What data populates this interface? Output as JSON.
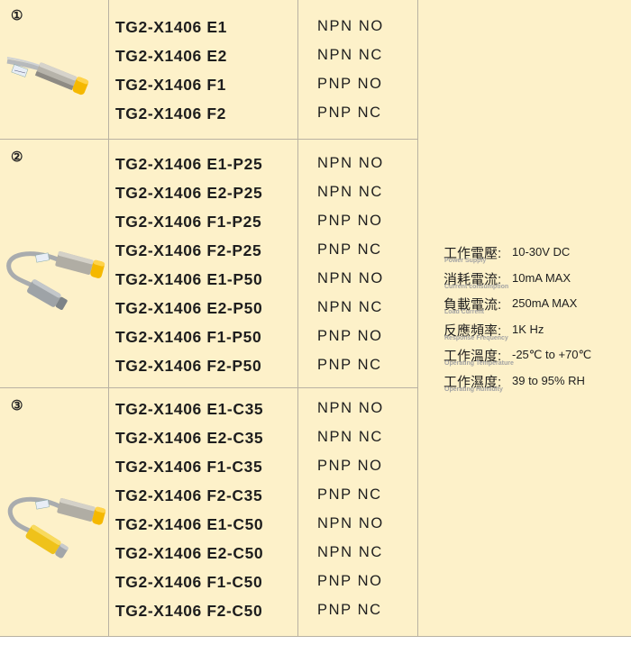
{
  "groups": [
    {
      "number": "①",
      "models": [
        "TG2-X1406 E1",
        "TG2-X1406 E2",
        "TG2-X1406 F1",
        "TG2-X1406 F2"
      ],
      "types": [
        "NPN NO",
        "NPN NC",
        "PNP NO",
        "PNP NC"
      ]
    },
    {
      "number": "②",
      "models": [
        "TG2-X1406 E1-P25",
        "TG2-X1406 E2-P25",
        "TG2-X1406 F1-P25",
        "TG2-X1406 F2-P25",
        "TG2-X1406 E1-P50",
        "TG2-X1406 E2-P50",
        "TG2-X1406 F1-P50",
        "TG2-X1406 F2-P50"
      ],
      "types": [
        "NPN NO",
        "NPN NC",
        "PNP NO",
        "PNP NC",
        "NPN NO",
        "NPN NC",
        "PNP NO",
        "PNP NC"
      ]
    },
    {
      "number": "③",
      "models": [
        "TG2-X1406 E1-C35",
        "TG2-X1406 E2-C35",
        "TG2-X1406 F1-C35",
        "TG2-X1406 F2-C35",
        "TG2-X1406 E1-C50",
        "TG2-X1406 E2-C50",
        "TG2-X1406 F1-C50",
        "TG2-X1406 F2-C50"
      ],
      "types": [
        "NPN NO",
        "NPN NC",
        "PNP NO",
        "PNP NC",
        "NPN NO",
        "NPN NC",
        "PNP NO",
        "PNP NC"
      ]
    }
  ],
  "specs": [
    {
      "label": "工作電壓",
      "sep": ":",
      "value": "10-30V DC",
      "en": "Power Supply"
    },
    {
      "label": "消耗電流",
      "sep": ":",
      "value": "10mA MAX",
      "en": "Current consumption"
    },
    {
      "label": "負載電流",
      "sep": ":",
      "value": "250mA MAX",
      "en": "Load Current"
    },
    {
      "label": "反應頻率",
      "sep": ":",
      "value": "1K Hz",
      "en": "Response Frequency"
    },
    {
      "label": "工作溫度",
      "sep": ":",
      "value": "-25℃ to +70℃",
      "en": "Operating Temperature"
    },
    {
      "label": "工作濕度",
      "sep": ":",
      "value": "39 to 95% RH",
      "en": "Operating Humidity"
    }
  ],
  "colors": {
    "cell_background": "#fdf1c9",
    "grid_line": "#b9b2a2",
    "sensor_cap": "#f5b800",
    "cable_grey": "#a9acae",
    "connector_yellow": "#efc21a"
  }
}
